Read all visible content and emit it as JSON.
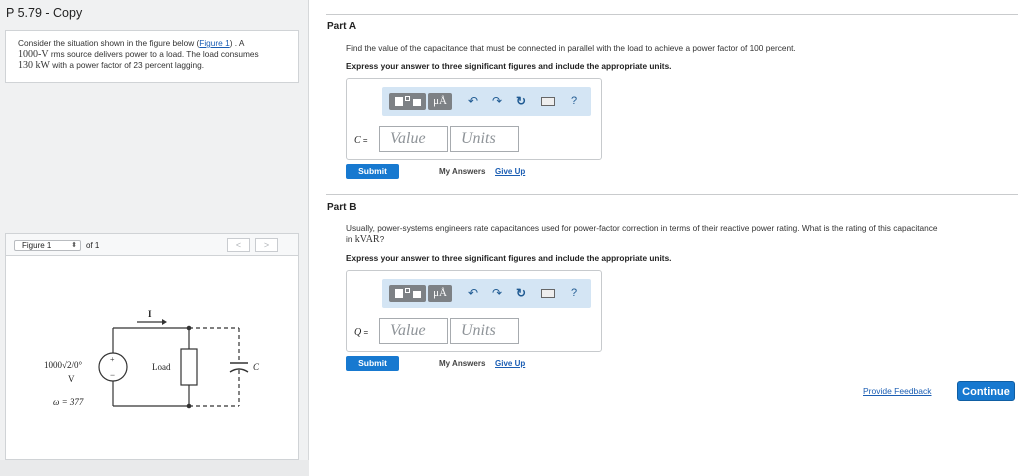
{
  "header": {
    "title": "P 5.79 - Copy"
  },
  "problem": {
    "text_1": "Consider the situation shown in the figure below (",
    "figure_link": "Figure 1",
    "text_2": ") . A",
    "line2_unit": "1000-V",
    "line2_rest": " rms source delivers power to a load. The load consumes",
    "line3_value": "130 kW",
    "line3_rest": " with a power factor of 23 percent lagging."
  },
  "figure_nav": {
    "selected": "Figure 1",
    "of_label": "of 1",
    "prev": "<",
    "next": ">"
  },
  "figure": {
    "source_label": "1000√2/0°",
    "source_unit": "V",
    "omega_label": "ω = 377",
    "current_label": "I",
    "load_label": "Load",
    "cap_label": "C",
    "plus": "+",
    "minus": "−"
  },
  "toolbar": {
    "mu_label": "μÅ",
    "undo": "↶",
    "redo": "↷",
    "reset": "↻",
    "keyboard": "kbd",
    "help": "?"
  },
  "part_a": {
    "title": "Part A",
    "question": "Find the value of the capacitance that must be connected in parallel with the load to achieve a power factor of 100 percent.",
    "instructions": "Express your answer to three significant figures and include the appropriate units.",
    "var": "C",
    "eq": " =",
    "value_placeholder": "Value",
    "units_placeholder": "Units",
    "submit": "Submit",
    "my_answers": "My Answers",
    "give_up": "Give Up"
  },
  "part_b": {
    "title": "Part B",
    "question_1": "Usually, power-systems engineers rate capacitances used for power-factor correction in terms of their reactive power rating. What is the rating of this capacitance",
    "question_2_pre": "in ",
    "question_2_unit": "kVAR",
    "question_2_post": "?",
    "instructions": "Express your answer to three significant figures and include the appropriate units.",
    "var": "Q",
    "eq": " =",
    "value_placeholder": "Value",
    "units_placeholder": "Units",
    "submit": "Submit",
    "my_answers": "My Answers",
    "give_up": "Give Up"
  },
  "footer": {
    "feedback": "Provide Feedback",
    "continue": "Continue"
  }
}
